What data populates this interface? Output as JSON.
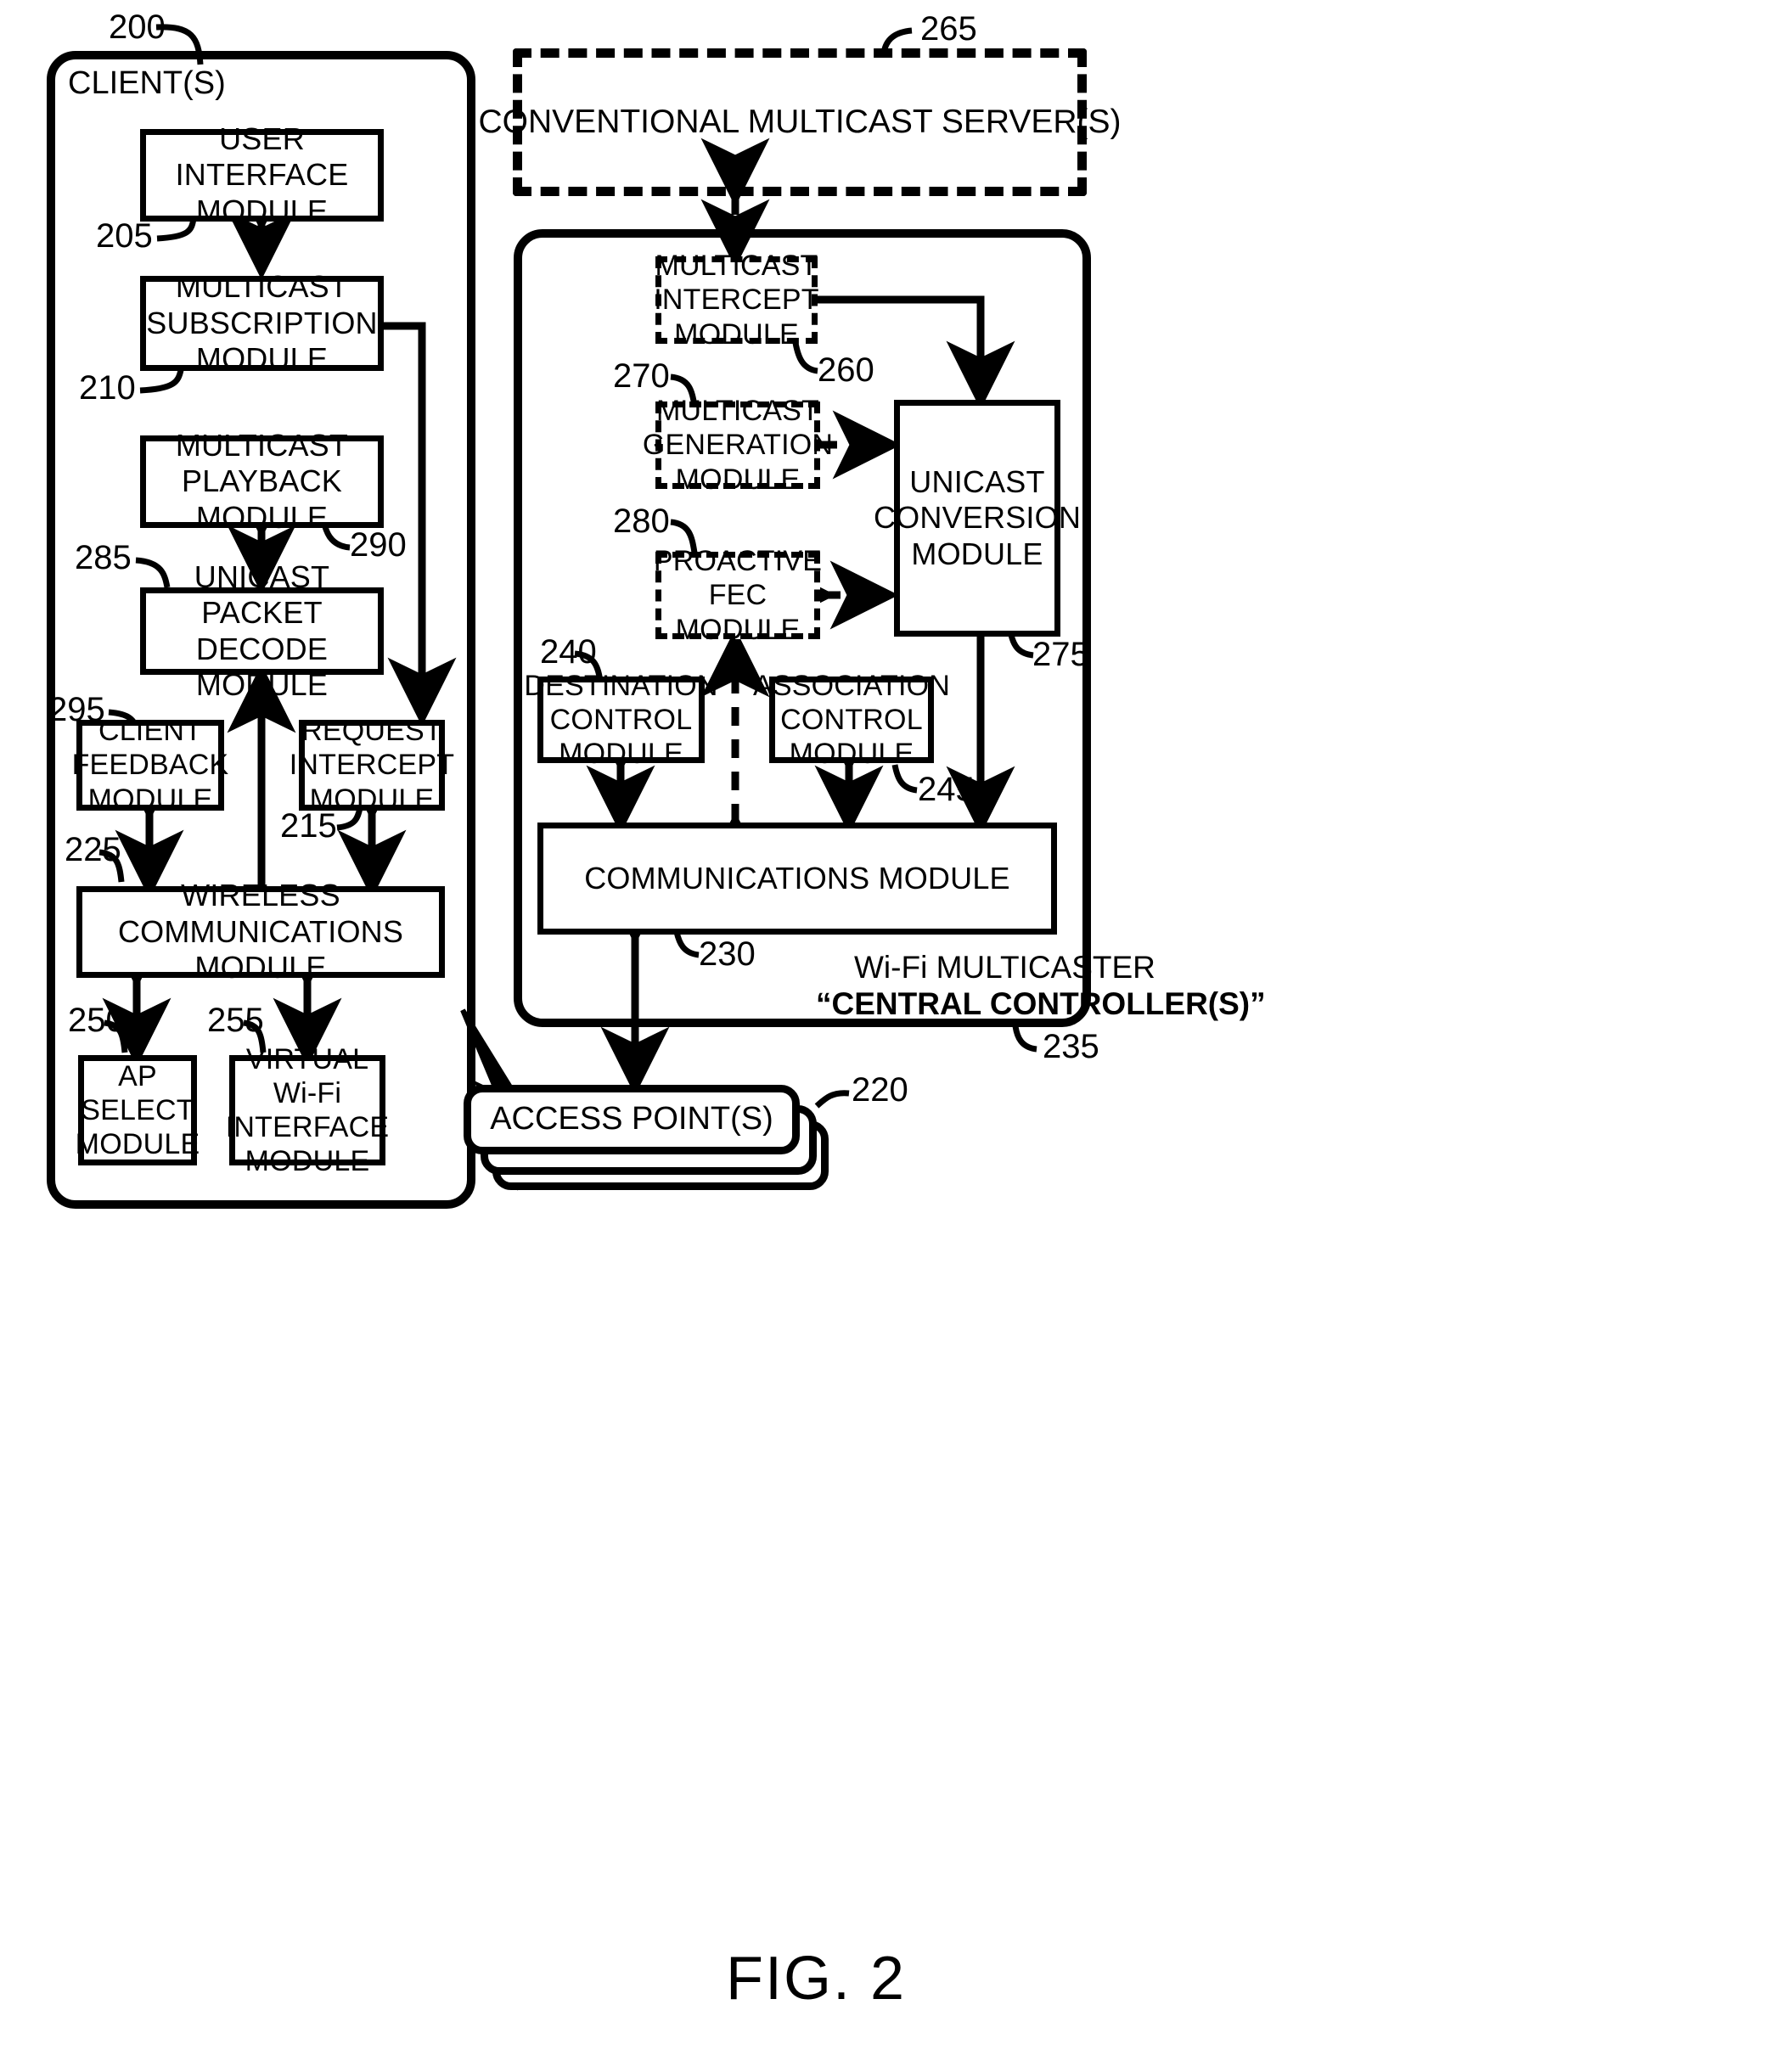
{
  "figure": {
    "caption": "FIG. 2",
    "client_panel_label": "CLIENT(S)",
    "controller_label_line1": "Wi-Fi MULTICASTER",
    "controller_label_line2": "“CENTRAL CONTROLLER(S)”"
  },
  "client": {
    "panel_ref": "200",
    "modules": [
      {
        "id": "user-interface",
        "text": "USER INTERFACE\nMODULE",
        "ref": "205"
      },
      {
        "id": "multicast-subscription",
        "text": "MULTICAST\nSUBSCRIPTION\nMODULE",
        "ref": "210"
      },
      {
        "id": "multicast-playback",
        "text": "MULTICAST\nPLAYBACK MODULE",
        "ref": "290"
      },
      {
        "id": "unicast-packet-decode",
        "text": "UNICAST PACKET\nDECODE MODULE",
        "ref": "285"
      },
      {
        "id": "client-feedback",
        "text": "CLIENT\nFEEDBACK\nMODULE",
        "ref": "295"
      },
      {
        "id": "request-intercept",
        "text": "REQUEST\nINTERCEPT\nMODULE",
        "ref": "215"
      },
      {
        "id": "wireless-communications",
        "text": "WIRELESS COMMUNICATIONS\nMODULE",
        "ref": "225"
      },
      {
        "id": "ap-select",
        "text": "AP\nSELECT\nMODULE",
        "ref": "250"
      },
      {
        "id": "virtual-wifi-interface",
        "text": "VIRTUAL\nWi-Fi\nINTERFACE\nMODULE",
        "ref": "255"
      }
    ]
  },
  "server": {
    "id": "conventional-multicast-server",
    "text": "CONVENTIONAL MULTICAST SERVER(S)",
    "ref": "265"
  },
  "controller": {
    "panel_ref": "235",
    "modules": [
      {
        "id": "multicast-intercept",
        "text": "MULTICAST\nINTERCEPT\nMODULE",
        "ref": "260",
        "style": "dashed"
      },
      {
        "id": "multicast-generation",
        "text": "MULTICAST\nGENERATION\nMODULE",
        "ref": "270",
        "style": "dashed"
      },
      {
        "id": "proactive-fec",
        "text": "PROACTIVE\nFEC MODULE",
        "ref": "280",
        "style": "dashed"
      },
      {
        "id": "unicast-conversion",
        "text": "UNICAST\nCONVERSION\nMODULE",
        "ref": "275",
        "style": "solid"
      },
      {
        "id": "destination-control",
        "text": "DESTINATION\nCONTROL\nMODULE",
        "ref": "240",
        "style": "solid"
      },
      {
        "id": "association-control",
        "text": "ASSOCIATION\nCONTROL\nMODULE",
        "ref": "245",
        "style": "solid"
      },
      {
        "id": "communications",
        "text": "COMMUNICATIONS MODULE",
        "ref": "230",
        "style": "solid"
      }
    ]
  },
  "access_point": {
    "id": "access-points",
    "text": "ACCESS POINT(S)",
    "ref": "220"
  },
  "colors": {
    "ink": "#000000",
    "paper": "#ffffff"
  }
}
